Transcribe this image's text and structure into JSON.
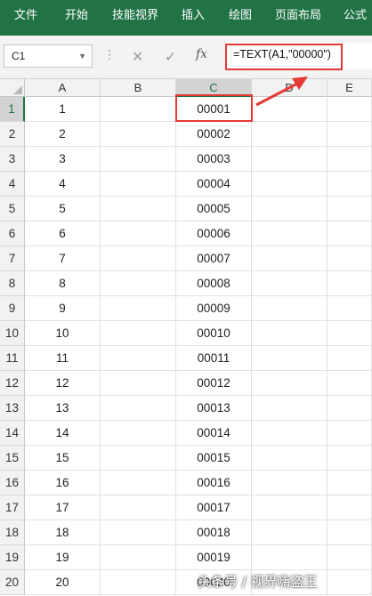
{
  "ribbon": {
    "tabs": [
      "文件",
      "开始",
      "技能视界",
      "插入",
      "绘图",
      "页面布局",
      "公式"
    ],
    "color": "#217346"
  },
  "formula_bar": {
    "name_box": "C1",
    "cancel_icon": "✕",
    "enter_icon": "✓",
    "fx_label": "fx",
    "formula": "=TEXT(A1,\"00000\")"
  },
  "sheet": {
    "columns": [
      "A",
      "B",
      "C",
      "D",
      "E"
    ],
    "selected_column": "C",
    "selected_cell": "C1",
    "rows": [
      {
        "n": "1",
        "a": "1",
        "c": "00001"
      },
      {
        "n": "2",
        "a": "2",
        "c": "00002"
      },
      {
        "n": "3",
        "a": "3",
        "c": "00003"
      },
      {
        "n": "4",
        "a": "4",
        "c": "00004"
      },
      {
        "n": "5",
        "a": "5",
        "c": "00005"
      },
      {
        "n": "6",
        "a": "6",
        "c": "00006"
      },
      {
        "n": "7",
        "a": "7",
        "c": "00007"
      },
      {
        "n": "8",
        "a": "8",
        "c": "00008"
      },
      {
        "n": "9",
        "a": "9",
        "c": "00009"
      },
      {
        "n": "10",
        "a": "10",
        "c": "00010"
      },
      {
        "n": "11",
        "a": "11",
        "c": "00011"
      },
      {
        "n": "12",
        "a": "12",
        "c": "00012"
      },
      {
        "n": "13",
        "a": "13",
        "c": "00013"
      },
      {
        "n": "14",
        "a": "14",
        "c": "00014"
      },
      {
        "n": "15",
        "a": "15",
        "c": "00015"
      },
      {
        "n": "16",
        "a": "16",
        "c": "00016"
      },
      {
        "n": "17",
        "a": "17",
        "c": "00017"
      },
      {
        "n": "18",
        "a": "18",
        "c": "00018"
      },
      {
        "n": "19",
        "a": "19",
        "c": "00019"
      },
      {
        "n": "20",
        "a": "20",
        "c": "00020"
      }
    ]
  },
  "annotation_color": "#e53935",
  "watermark": "头条号 / 视界嗨盗王"
}
